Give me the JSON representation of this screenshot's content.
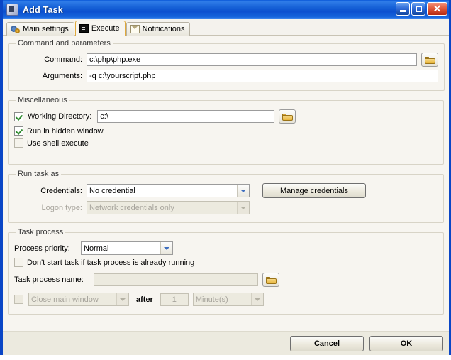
{
  "window": {
    "title": "Add Task",
    "app_icon": "app-icon",
    "controls": {
      "minimize": "minimize",
      "maximize": "maximize",
      "close": "✕"
    }
  },
  "tabs": [
    {
      "label": "Main settings",
      "icon": "gears-icon",
      "active": false
    },
    {
      "label": "Execute",
      "icon": "console-icon",
      "active": true
    },
    {
      "label": "Notifications",
      "icon": "mail-icon",
      "active": false
    }
  ],
  "groups": {
    "command": {
      "legend": "Command and parameters",
      "command_label": "Command:",
      "command_value": "c:\\php\\php.exe",
      "arguments_label": "Arguments:",
      "arguments_value": "-q c:\\yourscript.php"
    },
    "misc": {
      "legend": "Miscellaneous",
      "working_directory_label": "Working Directory:",
      "working_directory_value": "c:\\",
      "working_directory_checked": true,
      "run_hidden_label": "Run in hidden window",
      "run_hidden_checked": true,
      "shell_execute_label": "Use shell execute",
      "shell_execute_checked": false
    },
    "run_as": {
      "legend": "Run task as",
      "credentials_label": "Credentials:",
      "credentials_value": "No credential",
      "manage_credentials_label": "Manage credentials",
      "logon_type_label": "Logon type:",
      "logon_type_value": "Network credentials only",
      "logon_type_disabled": true
    },
    "task_process": {
      "legend": "Task process",
      "priority_label": "Process priority:",
      "priority_value": "Normal",
      "dont_start_label": "Don't start task if task process is already running",
      "dont_start_checked": false,
      "process_name_label": "Task process name:",
      "process_name_value": "",
      "close_window_checked": false,
      "close_window_value": "Close main window",
      "after_label": "after",
      "after_value": "1",
      "unit_value": "Minute(s)"
    }
  },
  "footer": {
    "cancel_label": "Cancel",
    "ok_label": "OK"
  }
}
